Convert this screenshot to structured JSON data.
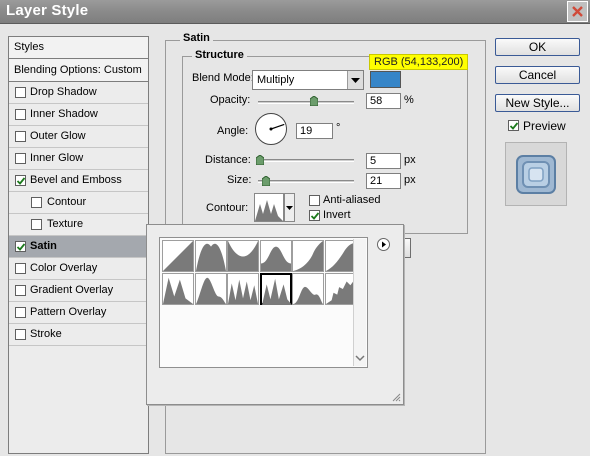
{
  "window": {
    "title": "Layer Style"
  },
  "styles_panel": {
    "header": "Styles",
    "blending_options": "Blending Options: Custom",
    "items": [
      {
        "label": "Drop Shadow",
        "checked": false,
        "indent": false,
        "selected": false
      },
      {
        "label": "Inner Shadow",
        "checked": false,
        "indent": false,
        "selected": false
      },
      {
        "label": "Outer Glow",
        "checked": false,
        "indent": false,
        "selected": false
      },
      {
        "label": "Inner Glow",
        "checked": false,
        "indent": false,
        "selected": false
      },
      {
        "label": "Bevel and Emboss",
        "checked": true,
        "indent": false,
        "selected": false
      },
      {
        "label": "Contour",
        "checked": false,
        "indent": true,
        "selected": false
      },
      {
        "label": "Texture",
        "checked": false,
        "indent": true,
        "selected": false
      },
      {
        "label": "Satin",
        "checked": true,
        "indent": false,
        "selected": true
      },
      {
        "label": "Color Overlay",
        "checked": false,
        "indent": false,
        "selected": false
      },
      {
        "label": "Gradient Overlay",
        "checked": false,
        "indent": false,
        "selected": false
      },
      {
        "label": "Pattern Overlay",
        "checked": false,
        "indent": false,
        "selected": false
      },
      {
        "label": "Stroke",
        "checked": false,
        "indent": false,
        "selected": false
      }
    ]
  },
  "satin": {
    "group_title": "Satin",
    "structure_title": "Structure",
    "blend_mode_label": "Blend Mode:",
    "blend_mode_value": "Multiply",
    "color_tooltip": "RGB (54,133,200)",
    "color": "#3685c8",
    "opacity_label": "Opacity:",
    "opacity_value": "58",
    "opacity_unit": "%",
    "opacity_fraction": 0.58,
    "angle_label": "Angle:",
    "angle_value": "19",
    "angle_unit": "°",
    "distance_label": "Distance:",
    "distance_value": "5",
    "distance_unit": "px",
    "distance_fraction": 0.02,
    "size_label": "Size:",
    "size_value": "21",
    "size_unit": "px",
    "size_fraction": 0.08,
    "contour_label": "Contour:",
    "anti_aliased_label": "Anti-aliased",
    "anti_aliased_checked": false,
    "invert_label": "Invert",
    "invert_checked": true
  },
  "buttons": {
    "ok": "OK",
    "cancel": "Cancel",
    "new_style": "New Style...",
    "preview_label": "Preview",
    "preview_checked": true
  },
  "contour_picker": {
    "selected_index": 9,
    "count": 12
  }
}
